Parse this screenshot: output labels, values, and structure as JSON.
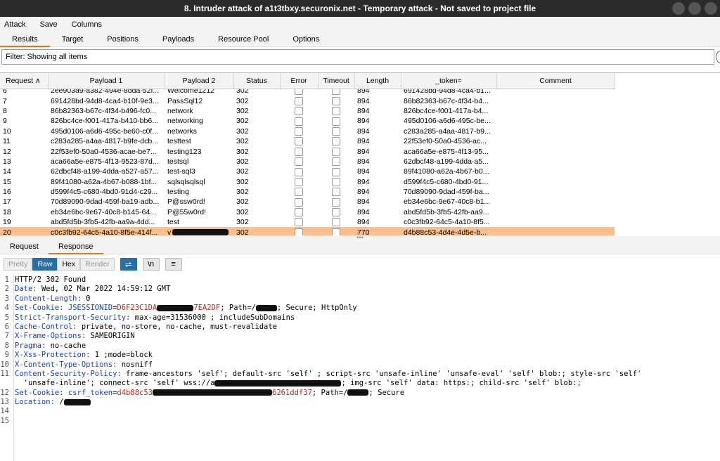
{
  "window": {
    "title": "8. Intruder attack of a1t3tbxy.securonix.net - Temporary attack - Not saved to project file"
  },
  "menu": [
    "Attack",
    "Save",
    "Columns"
  ],
  "tabs": [
    "Results",
    "Target",
    "Positions",
    "Payloads",
    "Resource Pool",
    "Options"
  ],
  "filter": {
    "text": "Filter: Showing all items"
  },
  "table": {
    "columns": [
      "Request",
      "Payload 1",
      "Payload 2",
      "Status",
      "Error",
      "Timeout",
      "Length",
      "_token=",
      "Comment"
    ],
    "rows": [
      {
        "req": "6",
        "p1": "2ee903a9-a382-494e-8dda-52f...",
        "p2": "Welcome1212",
        "status": "302",
        "len": "894",
        "token": "691428bd-94d8-4ca4-b1..."
      },
      {
        "req": "7",
        "p1": "691428bd-94d8-4ca4-b10f-9e3...",
        "p2": "PassSql12",
        "status": "302",
        "len": "894",
        "token": "86b82363-b67c-4f34-b4..."
      },
      {
        "req": "8",
        "p1": "86b82363-b67c-4f34-b496-fc0...",
        "p2": "network",
        "status": "302",
        "len": "894",
        "token": "826bc4ce-f001-417a-b4..."
      },
      {
        "req": "9",
        "p1": "826bc4ce-f001-417a-b410-bb6...",
        "p2": "networking",
        "status": "302",
        "len": "894",
        "token": "495d0106-a6d6-495c-be..."
      },
      {
        "req": "10",
        "p1": "495d0106-a6d6-495c-be60-c0f...",
        "p2": "networks",
        "status": "302",
        "len": "894",
        "token": "c283a285-a4aa-4817-b9..."
      },
      {
        "req": "11",
        "p1": "c283a285-a4aa-4817-b9fe-dcb...",
        "p2": "testtest",
        "status": "302",
        "len": "894",
        "token": "22f53ef0-50a0-4536-ac..."
      },
      {
        "req": "12",
        "p1": "22f53ef0-50a0-4536-acae-be7...",
        "p2": "testing123",
        "status": "302",
        "len": "894",
        "token": "aca66a5e-e875-4f13-95..."
      },
      {
        "req": "13",
        "p1": "aca66a5e-e875-4f13-9523-87d...",
        "p2": "testsql",
        "status": "302",
        "len": "894",
        "token": "62dbcf48-a199-4dda-a5..."
      },
      {
        "req": "14",
        "p1": "62dbcf48-a199-4dda-a527-a57...",
        "p2": "test-sql3",
        "status": "302",
        "len": "894",
        "token": "89f41080-a62a-4b67-b0..."
      },
      {
        "req": "15",
        "p1": "89f41080-a62a-4b67-b088-1bf...",
        "p2": "sqlsqlsqlsql",
        "status": "302",
        "len": "894",
        "token": "d599f4c5-c680-4bd0-91..."
      },
      {
        "req": "16",
        "p1": "d599f4c5-c680-4bd0-91d4-c29...",
        "p2": "testing",
        "status": "302",
        "len": "894",
        "token": "70d89090-9dad-459f-ba..."
      },
      {
        "req": "17",
        "p1": "70d89090-9dad-459f-ba19-adb...",
        "p2": "P@ssw0rd!",
        "status": "302",
        "len": "894",
        "token": "eb34e6bc-9e67-40c8-b1..."
      },
      {
        "req": "18",
        "p1": "eb34e6bc-9e67-40c8-b145-64...",
        "p2": "P@55w0rd!",
        "status": "302",
        "len": "894",
        "token": "abd5fd5b-3fb5-42fb-aa9..."
      },
      {
        "req": "19",
        "p1": "abd5fd5b-3fb5-42fb-aa9a-4dd...",
        "p2": "test",
        "status": "302",
        "len": "894",
        "token": "c0c3fb92-64c5-4a10-8f5..."
      },
      {
        "req": "20",
        "p1": "c0c3fb92-64c5-4a10-8f5e-414f...",
        "p2": "v",
        "status": "302",
        "len": "770",
        "token": "d4b88c53-4d4e-4d5e-b...",
        "selected": true
      }
    ]
  },
  "subtabs": [
    "Request",
    "Response"
  ],
  "viewer": {
    "pretty": "Pretty",
    "raw": "Raw",
    "hex": "Hex",
    "render": "Render",
    "newline": "\\n",
    "menu": "≡"
  },
  "response": [
    {
      "n": "1",
      "k": "",
      "v": "HTTP/2 302 Found",
      "rest": ""
    },
    {
      "n": "2",
      "k": "Date",
      "v": "",
      "rest": " Wed, 02 Mar 2022 14:59:12 GMT"
    },
    {
      "n": "3",
      "k": "Content-Length",
      "v": "",
      "rest": " 0"
    },
    {
      "n": "4",
      "k": "Set-Cookie",
      "v": " JSESSIONID",
      "eq": "=",
      "r": "D6F23C1DA",
      "rv2": "7EA2DF",
      "rest": "; Path=/",
      "rest2": "; Secure; HttpOnly"
    },
    {
      "n": "5",
      "k": "Strict-Transport-Security",
      "v": "",
      "rest": " max-age=31536000 ; includeSubDomains"
    },
    {
      "n": "6",
      "k": "Cache-Control",
      "v": "",
      "rest": " private, no-store, no-cache, must-revalidate"
    },
    {
      "n": "7",
      "k": "X-Frame-Options",
      "v": "",
      "rest": " SAMEORIGIN"
    },
    {
      "n": "8",
      "k": "Pragma",
      "v": "",
      "rest": " no-cache"
    },
    {
      "n": "9",
      "k": "X-Xss-Protection",
      "v": "",
      "rest": " 1 ;mode=block"
    },
    {
      "n": "10",
      "k": "X-Content-Type-Options",
      "v": "",
      "rest": " nosniff"
    },
    {
      "n": "11",
      "k": "Content-Security-Policy",
      "v": "",
      "rest": " frame-ancestors 'self'; default-src 'self' ; script-src 'unsafe-inline' 'unsafe-eval' 'self' blob:; style-src 'self'",
      "cont": "  'unsafe-inline'; connect-src 'self' wss://a",
      "cont2": "; img-src 'self' data: https:; child-src 'self' blob:;"
    },
    {
      "n": "12",
      "k": "Set-Cookie",
      "v": " csrf_token",
      "eq": "=",
      "r": "d4b88c53",
      "rv2": "6261ddf37",
      "rest": "; Path=/",
      "rest2": "; Secure"
    },
    {
      "n": "13",
      "k": "Location",
      "v": "",
      "rest": " /"
    },
    {
      "n": "14",
      "k": "",
      "v": "",
      "rest": ""
    },
    {
      "n": "15",
      "k": "",
      "v": "",
      "rest": ""
    }
  ]
}
